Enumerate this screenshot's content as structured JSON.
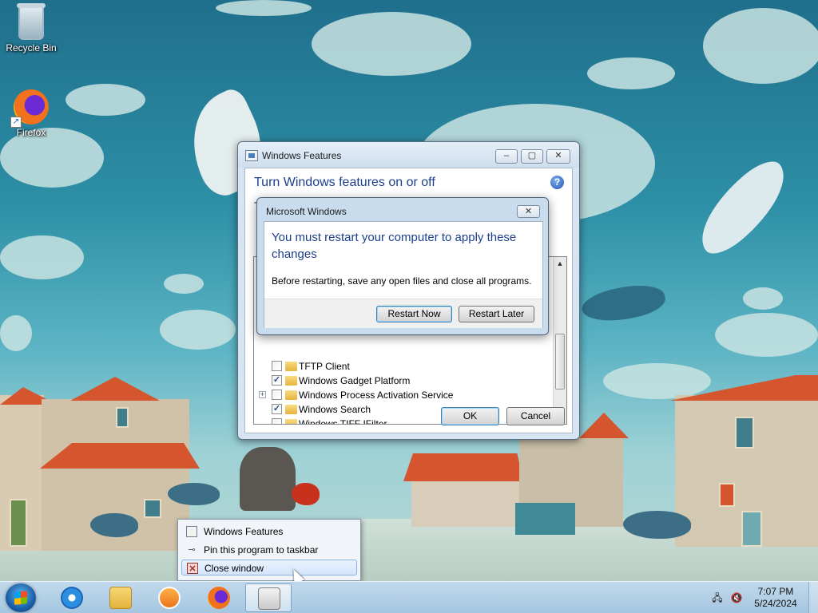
{
  "desktop": {
    "icons": [
      {
        "label": "Recycle Bin",
        "icon": "recycle-bin-icon"
      },
      {
        "label": "Firefox",
        "icon": "firefox-icon"
      }
    ]
  },
  "features_window": {
    "title": "Windows Features",
    "heading": "Turn Windows features on or off",
    "description_fragment": "T",
    "caption_buttons": {
      "minimize": "‒",
      "maximize": "▢",
      "close": "✕"
    },
    "features": [
      {
        "label": "TFTP Client",
        "checked": false,
        "expandable": false
      },
      {
        "label": "Windows Gadget Platform",
        "checked": true,
        "expandable": false
      },
      {
        "label": "Windows Process Activation Service",
        "checked": false,
        "expandable": true
      },
      {
        "label": "Windows Search",
        "checked": true,
        "expandable": false
      },
      {
        "label": "Windows TIFF IFilter",
        "checked": false,
        "expandable": false
      }
    ],
    "ok_label": "OK",
    "cancel_label": "Cancel"
  },
  "restart_dialog": {
    "title": "Microsoft Windows",
    "heading": "You must restart your computer to apply these changes",
    "message": "Before restarting, save any open files and close all programs.",
    "restart_now_label": "Restart Now",
    "restart_later_label": "Restart Later"
  },
  "jumplist": {
    "items": [
      {
        "label": "Windows Features",
        "icon": "windows-features-icon"
      },
      {
        "label": "Pin this program to taskbar",
        "icon": "pin-icon"
      },
      {
        "label": "Close window",
        "icon": "close-window-icon"
      }
    ]
  },
  "taskbar": {
    "pinned": [
      {
        "name": "Internet Explorer",
        "icon": "internet-explorer-icon"
      },
      {
        "name": "Windows Explorer",
        "icon": "file-explorer-icon"
      },
      {
        "name": "Windows Media Player",
        "icon": "media-player-icon"
      },
      {
        "name": "Firefox",
        "icon": "firefox-icon"
      },
      {
        "name": "Windows Features",
        "icon": "windows-features-icon",
        "active": true
      }
    ],
    "clock": {
      "time": "7:07 PM",
      "date": "5/24/2024"
    }
  },
  "colors": {
    "heading_blue": "#1b3f8b",
    "taskbar": "#a8c6e0",
    "default_button_border": "#3c7fb1"
  }
}
